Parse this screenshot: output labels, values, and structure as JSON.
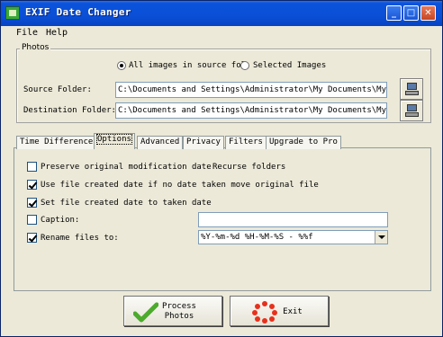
{
  "window": {
    "title": "EXIF Date Changer"
  },
  "titlebar": {
    "minimize": "_",
    "maximize": "□",
    "close": "✕"
  },
  "menu": {
    "file": "File",
    "help": "Help"
  },
  "photos": {
    "legend": "Photos",
    "radio_all": "All images in source fol",
    "radio_selected": "Selected Images",
    "source_label": "Source Folder:",
    "source_value": "C:\\Documents and Settings\\Administrator\\My Documents\\My Pi",
    "dest_label": "Destination Folder:",
    "dest_value": "C:\\Documents and Settings\\Administrator\\My Documents\\My Pi"
  },
  "tabs": [
    "Time Difference",
    "Options",
    "Advanced",
    "Privacy",
    "Filters",
    "Upgrade to Pro"
  ],
  "options": {
    "preserve": "Preserve original modification date",
    "recurse": "Recurse folders",
    "use_created": "Use file created date if no date taken move original file",
    "set_created": "Set file created date to taken date",
    "caption": "Caption:",
    "caption_value": "",
    "rename": "Rename files to:",
    "rename_value": "%Y-%m-%d %H-%M-%S - %%f"
  },
  "buttons": {
    "process_line1": "Process",
    "process_line2": "Photos",
    "exit": "Exit"
  },
  "icons": {
    "app": "app-icon",
    "browse": "computer-icon",
    "process": "checkmark-icon",
    "exit": "exit-burst-icon"
  },
  "colors": {
    "titlebar": "#0a4fd6",
    "window_bg": "#ece9d8",
    "process_check": "#4caa2c",
    "exit_burst": "#e8301c"
  }
}
